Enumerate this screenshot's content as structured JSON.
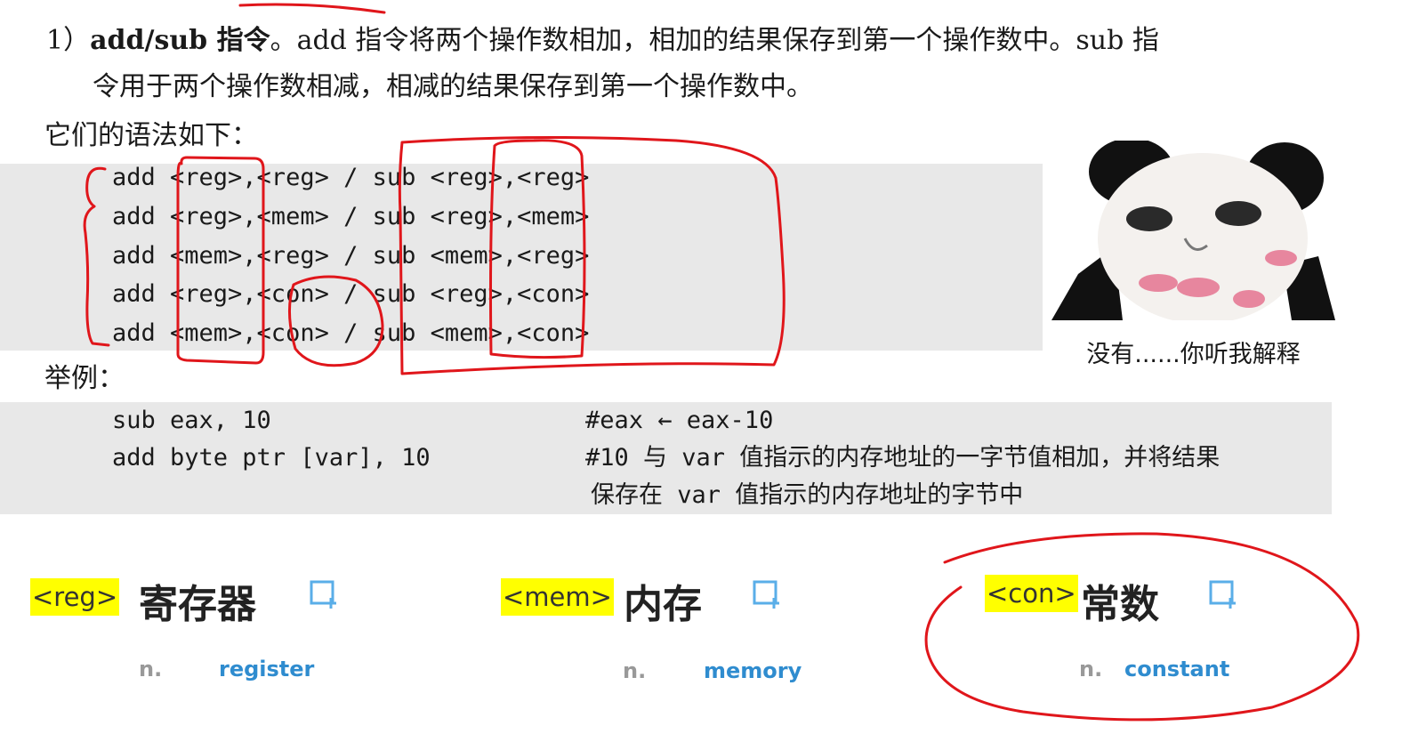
{
  "intro": {
    "num": "1）",
    "heading": "add/sub 指令",
    "line1_rest": "。add 指令将两个操作数相加，相加的结果保存到第一个操作数中。sub 指",
    "line2": "令用于两个操作数相减，相减的结果保存到第一个操作数中。",
    "syntax_label": "它们的语法如下："
  },
  "syntax_rows": [
    "add <reg>,<reg> / sub <reg>,<reg>",
    "add <reg>,<mem> / sub <reg>,<mem>",
    "add <mem>,<reg> / sub <mem>,<reg>",
    "add <reg>,<con> / sub <reg>,<con>",
    "add <mem>,<con> / sub <mem>,<con>"
  ],
  "example_label": "举例：",
  "examples": [
    {
      "code": "sub eax, 10",
      "comment": "#eax ← eax-10"
    },
    {
      "code": "add byte ptr [var], 10",
      "comment": "#10 与 var 值指示的内存地址的一字节值相加，并将结果",
      "comment2": "保存在 var 值指示的内存地址的字节中"
    }
  ],
  "meme": {
    "caption": "没有......你听我解释",
    "icon": "panda-meme-image"
  },
  "vocab": [
    {
      "tag": "<reg>",
      "word": "寄存器",
      "pos": "n.",
      "english": "register",
      "icon": "add-note-icon"
    },
    {
      "tag": "<mem>",
      "word": "内存",
      "pos": "n.",
      "english": "memory",
      "icon": "add-note-icon"
    },
    {
      "tag": "<con>",
      "word": "常数",
      "pos": "n.",
      "english": "constant",
      "icon": "add-note-icon"
    }
  ],
  "colors": {
    "highlight": "#ffff00",
    "english": "#2f8ccf",
    "ink": "#e0161b",
    "code_bg": "#e8e8e8"
  }
}
